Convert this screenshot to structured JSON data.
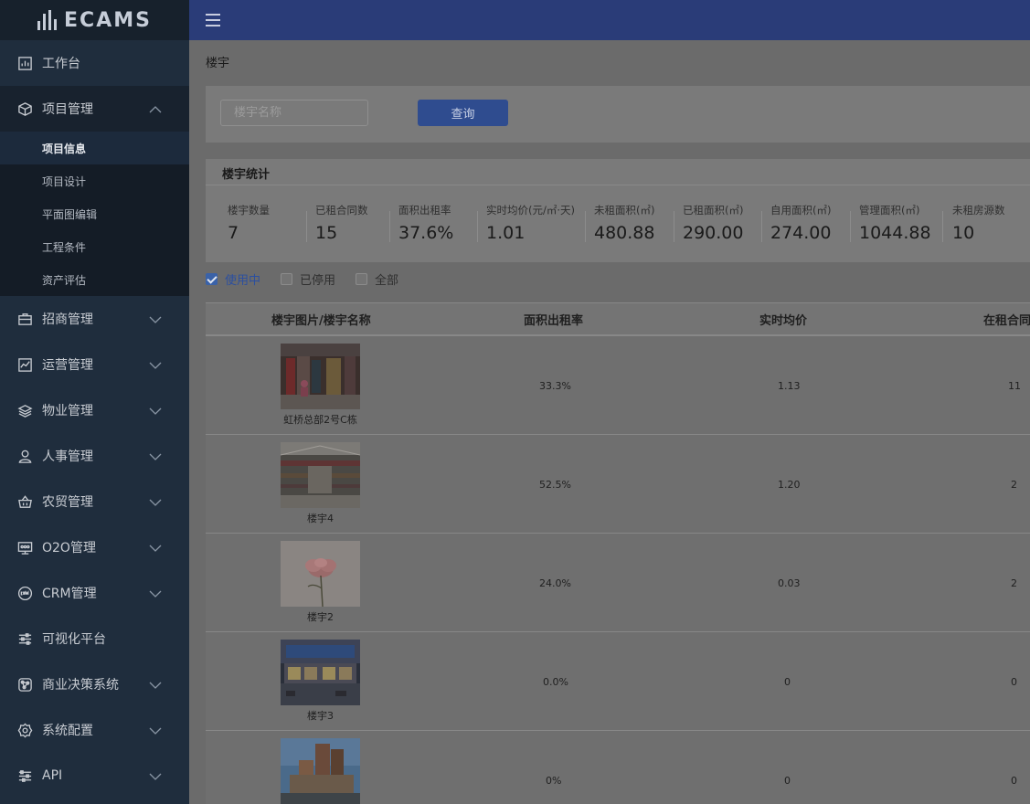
{
  "app": {
    "logo_text": "ECAMS"
  },
  "sidebar": {
    "items": [
      {
        "label": "工作台",
        "icon": "chart-icon",
        "open": false
      },
      {
        "label": "项目管理",
        "icon": "cube-icon",
        "open": true,
        "children": [
          {
            "label": "项目信息",
            "active": true
          },
          {
            "label": "项目设计",
            "active": false
          },
          {
            "label": "平面图编辑",
            "active": false
          },
          {
            "label": "工程条件",
            "active": false
          },
          {
            "label": "资产评估",
            "active": false
          }
        ]
      },
      {
        "label": "招商管理",
        "icon": "briefcase-icon"
      },
      {
        "label": "运营管理",
        "icon": "trend-icon"
      },
      {
        "label": "物业管理",
        "icon": "layers-icon"
      },
      {
        "label": "人事管理",
        "icon": "user-icon"
      },
      {
        "label": "农贸管理",
        "icon": "basket-icon"
      },
      {
        "label": "O2O管理",
        "icon": "o2o-icon"
      },
      {
        "label": "CRM管理",
        "icon": "crm-icon"
      },
      {
        "label": "可视化平台",
        "icon": "sliders-icon"
      },
      {
        "label": "商业决策系统",
        "icon": "network-icon"
      },
      {
        "label": "系统配置",
        "icon": "gear-icon"
      },
      {
        "label": "API",
        "icon": "api-icon"
      }
    ]
  },
  "breadcrumb": "楼宇",
  "search": {
    "placeholder": "楼宇名称",
    "button_label": "查询"
  },
  "stats": {
    "title": "楼宇统计",
    "items": [
      {
        "label": "楼宇数量",
        "value": "7"
      },
      {
        "label": "已租合同数",
        "value": "15"
      },
      {
        "label": "面积出租率",
        "value": "37.6%"
      },
      {
        "label": "实时均价(元/㎡·天)",
        "value": "1.01"
      },
      {
        "label": "未租面积(㎡)",
        "value": "480.88"
      },
      {
        "label": "已租面积(㎡)",
        "value": "290.00"
      },
      {
        "label": "自用面积(㎡)",
        "value": "274.00"
      },
      {
        "label": "管理面积(㎡)",
        "value": "1044.88"
      },
      {
        "label": "未租房源数",
        "value": "10"
      }
    ]
  },
  "filters": [
    {
      "label": "使用中",
      "checked": true
    },
    {
      "label": "已停用",
      "checked": false
    },
    {
      "label": "全部",
      "checked": false
    }
  ],
  "table": {
    "headers": [
      "楼宇图片/楼宇名称",
      "面积出租率",
      "实时均价",
      "在租合同"
    ],
    "rows": [
      {
        "name": "虹桥总部2号C栋",
        "rate": "33.3%",
        "price": "1.13",
        "contracts": "11",
        "image": "mall-interior"
      },
      {
        "name": "楼宇4",
        "rate": "52.5%",
        "price": "1.20",
        "contracts": "2",
        "image": "mall-atrium"
      },
      {
        "name": "楼宇2",
        "rate": "24.0%",
        "price": "0.03",
        "contracts": "2",
        "image": "flower"
      },
      {
        "name": "楼宇3",
        "rate": "0.0%",
        "price": "0",
        "contracts": "0",
        "image": "storefront"
      },
      {
        "name": "",
        "rate": "0%",
        "price": "0",
        "contracts": "0",
        "image": "building"
      }
    ]
  }
}
